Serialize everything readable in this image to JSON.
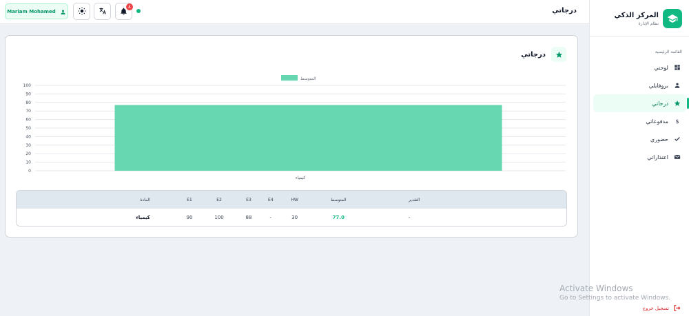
{
  "brand": {
    "title": "المركز الذكي",
    "subtitle": "نظام الإدارة"
  },
  "sidebar": {
    "heading": "القائمة الرئيسية",
    "items": [
      {
        "label": "لوحتي",
        "icon": "dashboard-icon",
        "active": false
      },
      {
        "label": "بروفايلي",
        "icon": "user-icon",
        "active": false
      },
      {
        "label": "درجاتي",
        "icon": "star-icon",
        "active": true
      },
      {
        "label": "مدفوعاتي",
        "icon": "dollar-icon",
        "active": false
      },
      {
        "label": "حضوري",
        "icon": "check-icon",
        "active": false
      },
      {
        "label": "اعتذاراتي",
        "icon": "mail-icon",
        "active": false
      }
    ],
    "logout": "تسجيل خروج"
  },
  "topbar": {
    "title": "درجاتي",
    "user_name": "Mariam Mohamed",
    "notifications_count": "4"
  },
  "card": {
    "title": "درجاتي"
  },
  "chart_data": {
    "type": "bar",
    "categories": [
      "كيمياء"
    ],
    "series": [
      {
        "name": "المتوسط",
        "values": [
          77
        ]
      }
    ],
    "ylim": [
      0,
      100
    ],
    "yticks": [
      0,
      10,
      20,
      30,
      40,
      50,
      60,
      70,
      80,
      90,
      100
    ],
    "grid": true,
    "legend": "top-center",
    "color": "#66d7b1"
  },
  "table": {
    "headers": [
      "المادة",
      "E1",
      "E2",
      "E3",
      "E4",
      "HW",
      "المتوسط",
      "التقدير"
    ],
    "rows": [
      [
        "كيمياء",
        "90",
        "100",
        "88",
        "-",
        "30",
        "77.0",
        "-"
      ]
    ]
  },
  "watermark": {
    "line1": "Activate Windows",
    "line2": "Go to Settings to activate Windows."
  },
  "colors": {
    "accent": "#10b981",
    "danger": "#ef4444"
  }
}
